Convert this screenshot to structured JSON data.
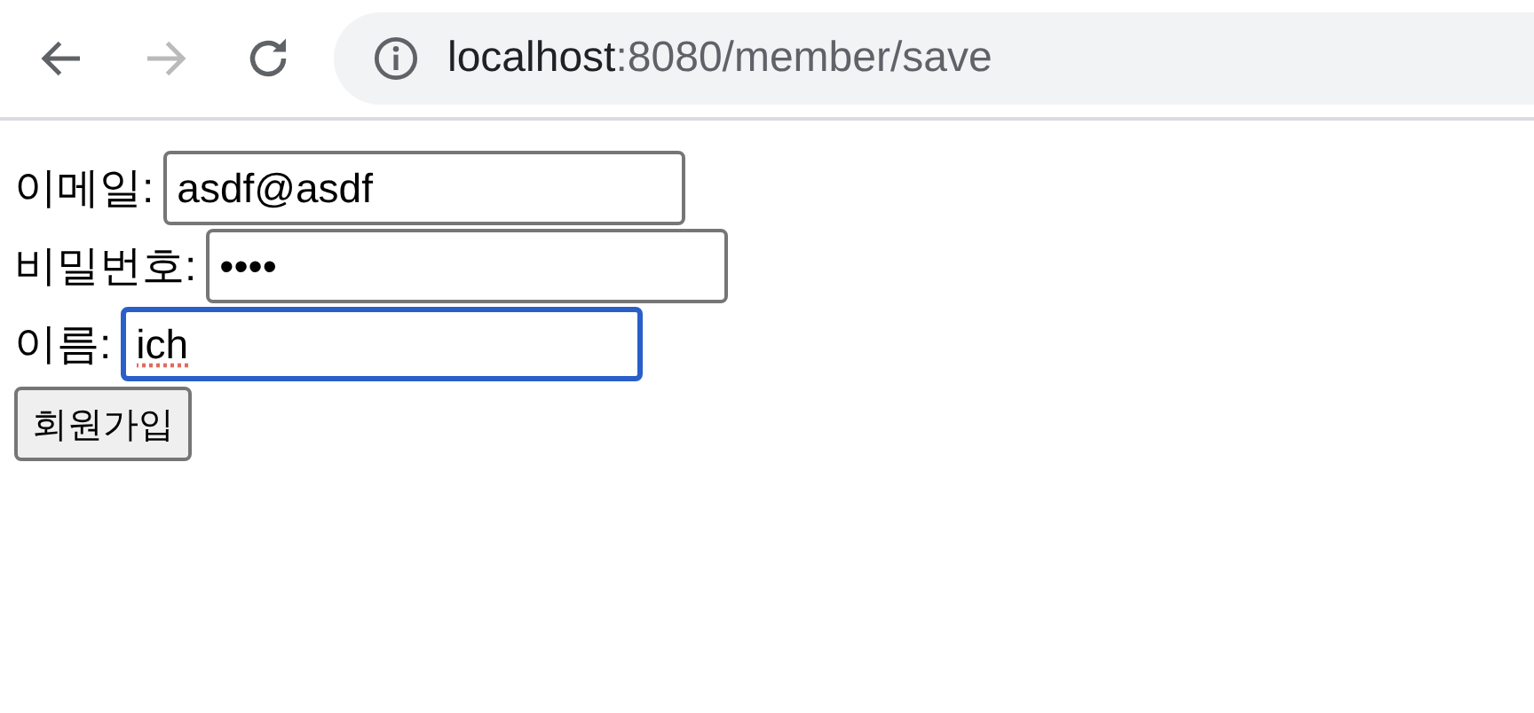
{
  "browser": {
    "back_disabled": false,
    "forward_disabled": true,
    "url_host": "localhost",
    "url_path": ":8080/member/save"
  },
  "form": {
    "fields": [
      {
        "label": "이메일:",
        "value": "asdf@asdf",
        "focused": false,
        "misspelled": false
      },
      {
        "label": "비밀번호:",
        "value": "••••",
        "focused": false,
        "misspelled": false
      },
      {
        "label": "이름:",
        "value": "ich",
        "focused": true,
        "misspelled": true
      }
    ],
    "submit": "회원가입"
  }
}
